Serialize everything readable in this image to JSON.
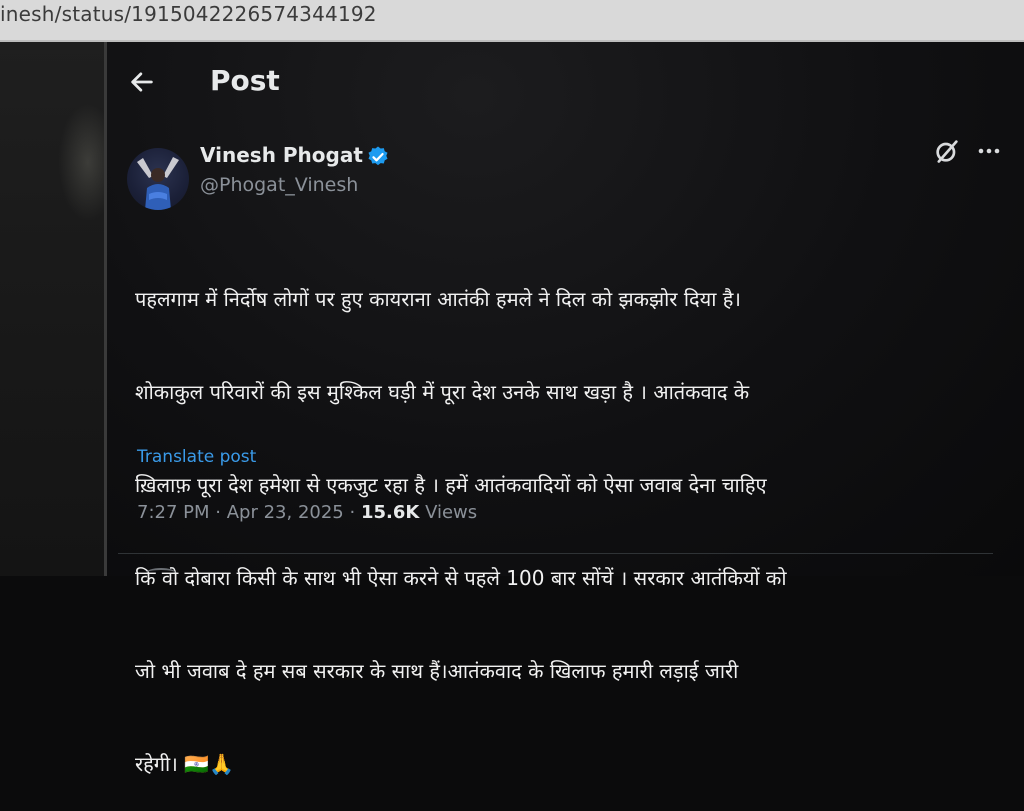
{
  "browser": {
    "url": "inesh/status/1915042226574344192"
  },
  "header": {
    "title": "Post"
  },
  "post": {
    "author": {
      "name": "Vinesh Phogat",
      "handle": "@Phogat_Vinesh",
      "verified": true,
      "verified_color": "#1d9bf0"
    },
    "lines": [
      "पहलगाम में निर्दोष लोगों पर हुए कायराना आतंकी हमले ने दिल को झकझोर दिया है।",
      "शोकाकुल परिवारों की इस मुश्किल घड़ी में पूरा देश उनके साथ खड़ा है । आतंकवाद के",
      "ख़िलाफ़ पूरा देश हमेशा से एकजुट रहा है । हमें आतंकवादियों को ऐसा जवाब देना चाहिए",
      "कि वो दोबारा किसी के साथ भी ऐसा करने से पहले 100 बार सोंचें । सरकार आतंकियों को",
      "जो भी जवाब दे हम सब सरकार के साथ हैं।आतंकवाद के खिलाफ हमारी लड़ाई जारी",
      "रहेगी। 🇮🇳🙏"
    ],
    "translate_label": "Translate post",
    "time": "7:27 PM",
    "date": "Apr 23, 2025",
    "views_count": "15.6K",
    "views_label": "Views",
    "separator": "·"
  },
  "icons": {
    "back": "arrow-left-icon",
    "verified": "verified-badge-icon",
    "grok": "grok-icon",
    "more": "more-options-icon"
  },
  "colors": {
    "link": "#3a9ae8",
    "text": "#e7e9ea",
    "secondary": "#8b9199"
  }
}
